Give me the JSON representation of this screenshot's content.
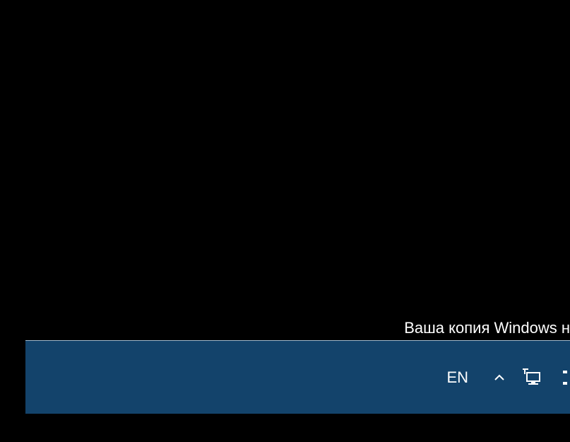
{
  "desktop": {
    "activation_message": "Ваша копия Windows н"
  },
  "taskbar": {
    "language": "EN"
  }
}
